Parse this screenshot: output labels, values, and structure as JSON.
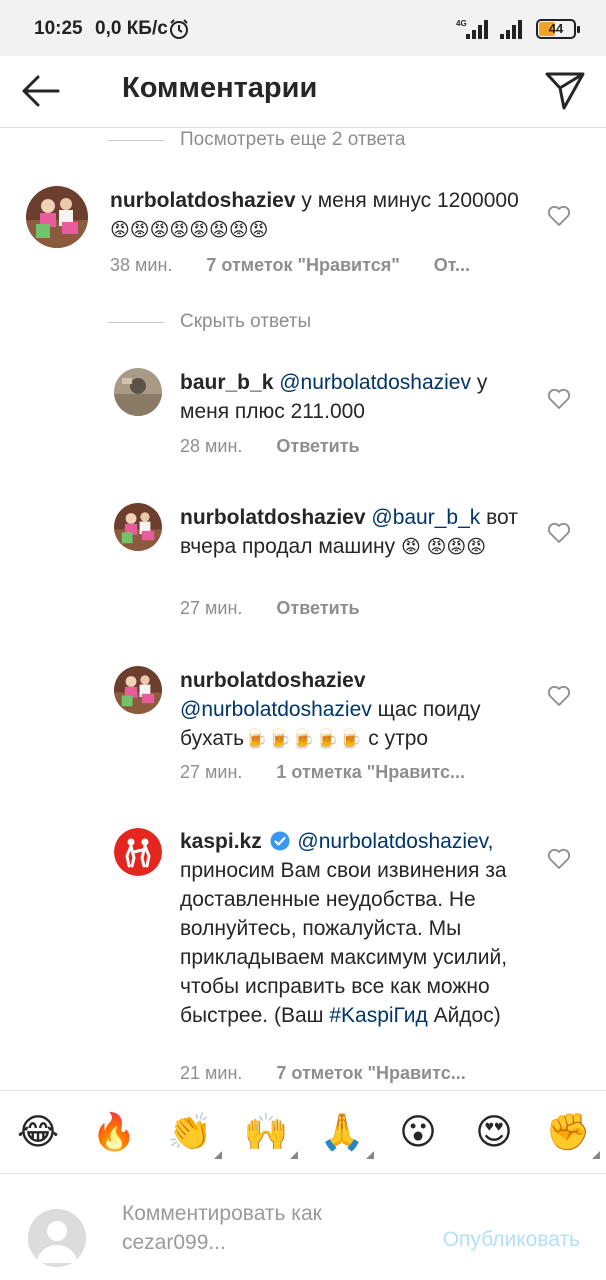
{
  "status_bar": {
    "time": "10:25",
    "speed": "0,0 КБ/с",
    "network": "4G",
    "battery": "44"
  },
  "header": {
    "title": "Комментарии"
  },
  "view_more_replies": "Посмотреть еще 2 ответа",
  "hide_replies": "Скрыть ответы",
  "comments": [
    {
      "username": "nurbolatdoshaziev",
      "text": "у меня минус 1200000",
      "emojis": "😡😡😡😡😡😡😡😡",
      "time": "38 мин.",
      "likes": "7 отметок \"Нравится\"",
      "reply": "От..."
    }
  ],
  "replies": [
    {
      "username": "baur_b_k",
      "mention": "@nurbolatdoshaziev",
      "text": "у меня плюс 211.000",
      "time": "28 мин.",
      "action": "Ответить"
    },
    {
      "username": "nurbolatdoshaziev",
      "mention": "@baur_b_k",
      "text": "вот вчера продал машину",
      "emojis": "😡",
      "emojis2": "😡😡😡",
      "time": "27 мин.",
      "action": "Ответить"
    },
    {
      "username": "nurbolatdoshaziev",
      "mention": "@nurbolatdoshaziev",
      "text_a": "щас поиду",
      "text_b": "бухать",
      "emojis": "🍺🍺🍺🍺🍺",
      "text_c": "с утро",
      "time": "27 мин.",
      "action": "1 отметка \"Нравитс..."
    },
    {
      "username": "kaspi.kz",
      "mention": "@nurbolatdoshaziev,",
      "text": "приносим Вам свои извинения за доставленные неудобства. Не волнуйтесь, пожалуйста. Мы прикладываем максимум усилий, чтобы исправить все как можно быстрее. (Ваш",
      "hashtag": "#KaspiГид",
      "text_end": "Айдос)",
      "time": "21 мин.",
      "action": "7 отметок \"Нравитс..."
    }
  ],
  "emoji_bar": [
    "😂",
    "🔥",
    "👏",
    "🙌",
    "🙏",
    "😮",
    "😍",
    "✊"
  ],
  "composer": {
    "placeholder": "Комментировать как cezar099...",
    "publish": "Опубликовать"
  },
  "colors": {
    "mention": "#003569",
    "muted": "#8e8e8e",
    "publish": "#b2dffc"
  }
}
